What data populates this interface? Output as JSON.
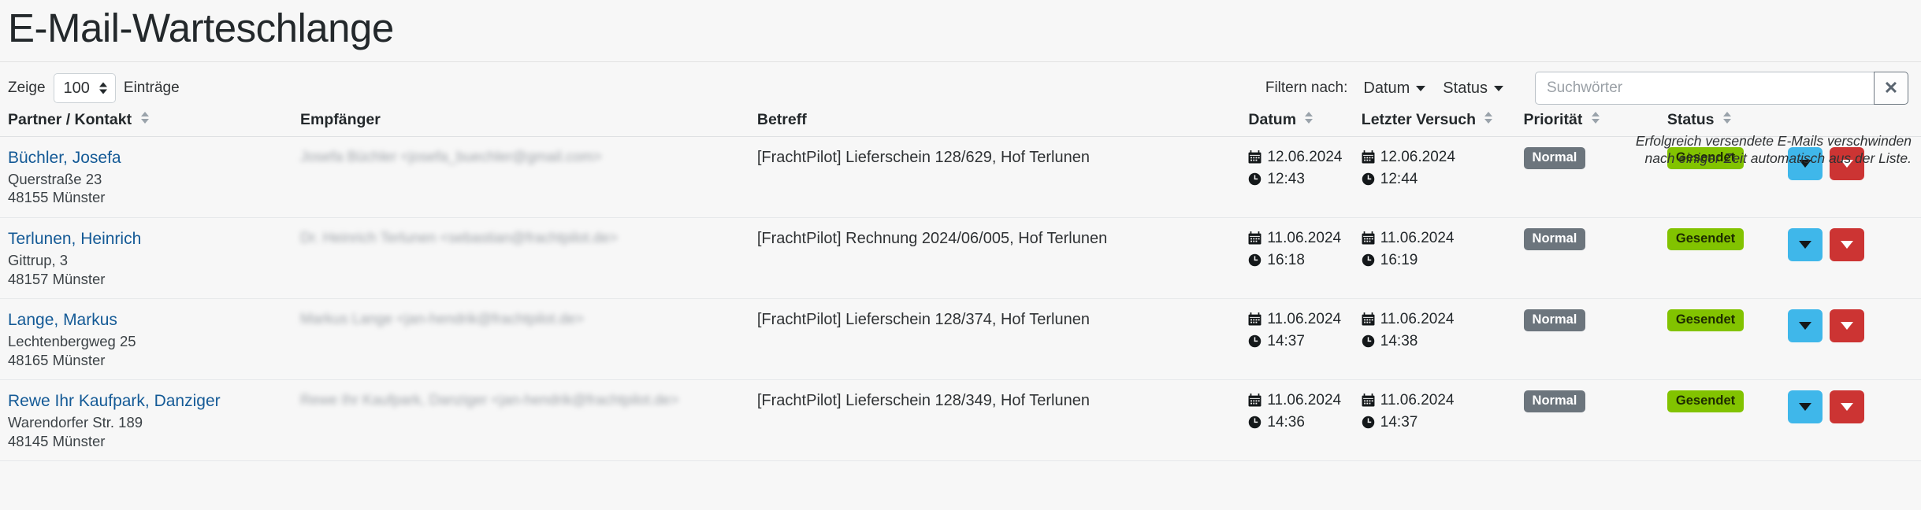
{
  "header": {
    "title": "E-Mail-Warteschlange"
  },
  "controls": {
    "show_label": "Zeige",
    "page_length": "100",
    "entries_label": "Einträge",
    "filter_label": "Filtern nach:",
    "filter_date": "Datum",
    "filter_status": "Status",
    "search_placeholder": "Suchwörter",
    "search_value": "",
    "clear_label": "✕"
  },
  "note": "Erfolgreich versendete E-Mails verschwinden nach einiger Zeit automatisch aus der Liste.",
  "table": {
    "columns": [
      {
        "label": "Partner / Kontakt",
        "sortable": true
      },
      {
        "label": "Empfänger",
        "sortable": false
      },
      {
        "label": "Betreff",
        "sortable": false
      },
      {
        "label": "Datum",
        "sortable": true
      },
      {
        "label": "Letzter Versuch",
        "sortable": true
      },
      {
        "label": "Priorität",
        "sortable": true
      },
      {
        "label": "Status",
        "sortable": true
      },
      {
        "label": "",
        "sortable": false
      }
    ],
    "rows": [
      {
        "contact_name": "Büchler, Josefa",
        "contact_street": "Querstraße 23",
        "contact_city": "48155 Münster",
        "recipient": "Josefa Büchler <josefa_buechler@gmail.com>",
        "subject": "[FrachtPilot] Lieferschein 128/629, Hof Terlunen",
        "date": "12.06.2024",
        "time": "12:43",
        "last_date": "12.06.2024",
        "last_time": "12:44",
        "priority": "Normal",
        "status": "Gesendet"
      },
      {
        "contact_name": "Terlunen, Heinrich",
        "contact_street": "Gittrup, 3",
        "contact_city": "48157 Münster",
        "recipient": "Dr. Heinrich Terlunen <sebastian@frachtpilot.de>",
        "subject": "[FrachtPilot] Rechnung 2024/06/005, Hof Terlunen",
        "date": "11.06.2024",
        "time": "16:18",
        "last_date": "11.06.2024",
        "last_time": "16:19",
        "priority": "Normal",
        "status": "Gesendet"
      },
      {
        "contact_name": "Lange, Markus",
        "contact_street": "Lechtenbergweg 25",
        "contact_city": "48165 Münster",
        "recipient": "Markus Lange <jan-hendrik@frachtpilot.de>",
        "subject": "[FrachtPilot] Lieferschein 128/374, Hof Terlunen",
        "date": "11.06.2024",
        "time": "14:37",
        "last_date": "11.06.2024",
        "last_time": "14:38",
        "priority": "Normal",
        "status": "Gesendet"
      },
      {
        "contact_name": "Rewe Ihr Kaufpark, Danziger",
        "contact_street": "Warendorfer Str. 189",
        "contact_city": "48145 Münster",
        "recipient": "Rewe Ihr Kaufpark, Danziger <jan-hendrik@frachtpilot.de>",
        "subject": "[FrachtPilot] Lieferschein 128/349, Hof Terlunen",
        "date": "11.06.2024",
        "time": "14:36",
        "last_date": "11.06.2024",
        "last_time": "14:37",
        "priority": "Normal",
        "status": "Gesendet"
      }
    ]
  },
  "colors": {
    "link": "#145a96",
    "badge_normal_bg": "#6c757d",
    "badge_sent_bg": "#82c300",
    "action_blue": "#3fb7ea",
    "action_red": "#cc3433",
    "page_bg": "#f7f7f7"
  },
  "icons": {
    "calendar": "calendar-icon",
    "clock": "clock-icon",
    "detail_button": "chevron-down-icon",
    "delete_button": "chevron-down-icon"
  }
}
